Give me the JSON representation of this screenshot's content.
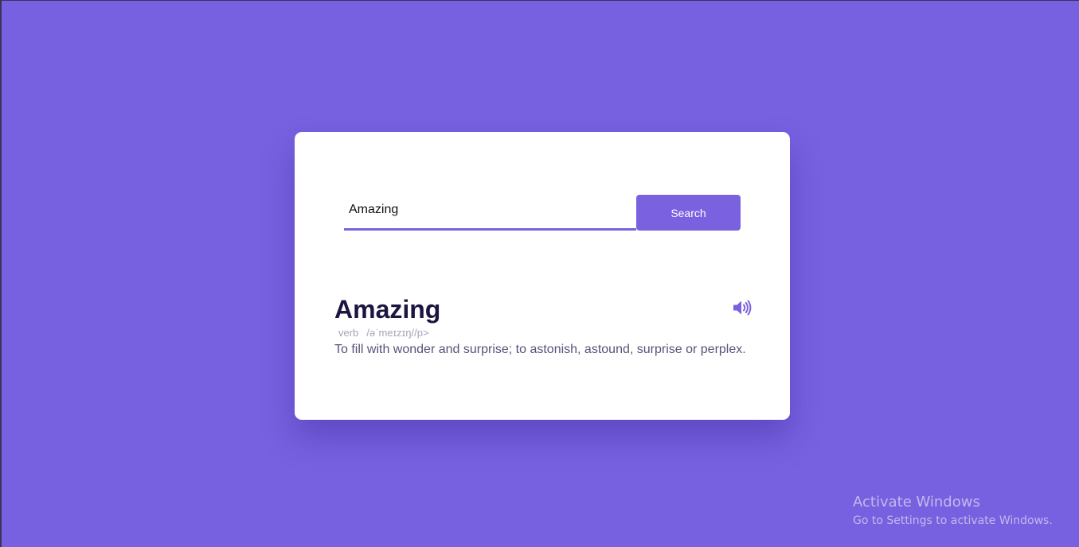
{
  "colors": {
    "background": "#7a61df",
    "card": "#ffffff",
    "accent": "#7a61df",
    "word": "#1b1640",
    "meaning": "#575378",
    "details": "#a7a3b8"
  },
  "search": {
    "value": "Amazing",
    "button_label": "Search"
  },
  "result": {
    "word": "Amazing",
    "part_of_speech": "verb",
    "phonetic": "/əˈmeɪzɪŋ//p>",
    "meaning": "To fill with wonder and surprise; to astonish, astound, surprise or perplex.",
    "sound_icon": "speaker-volume-icon"
  },
  "watermark": {
    "title": "Activate Windows",
    "subtitle": "Go to Settings to activate Windows."
  }
}
